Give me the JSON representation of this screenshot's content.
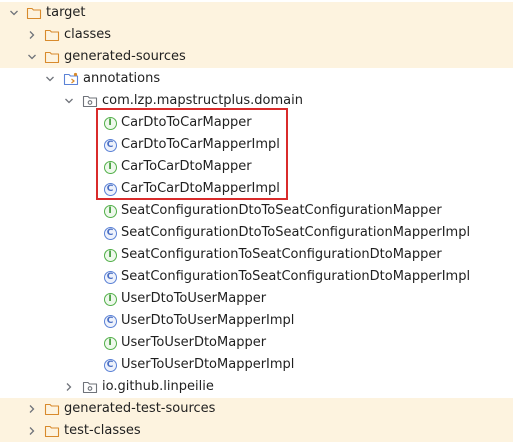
{
  "tree": {
    "target": "target",
    "classes": "classes",
    "generated_sources": "generated-sources",
    "annotations": "annotations",
    "package_domain": "com.lzp.mapstructplus.domain",
    "items": [
      {
        "label": "CarDtoToCarMapper",
        "kind": "interface",
        "badge": "I"
      },
      {
        "label": "CarDtoToCarMapperImpl",
        "kind": "class",
        "badge": "C"
      },
      {
        "label": "CarToCarDtoMapper",
        "kind": "interface",
        "badge": "I"
      },
      {
        "label": "CarToCarDtoMapperImpl",
        "kind": "class",
        "badge": "C"
      },
      {
        "label": "SeatConfigurationDtoToSeatConfigurationMapper",
        "kind": "interface",
        "badge": "I"
      },
      {
        "label": "SeatConfigurationDtoToSeatConfigurationMapperImpl",
        "kind": "class",
        "badge": "C"
      },
      {
        "label": "SeatConfigurationToSeatConfigurationDtoMapper",
        "kind": "interface",
        "badge": "I"
      },
      {
        "label": "SeatConfigurationToSeatConfigurationDtoMapperImpl",
        "kind": "class",
        "badge": "C"
      },
      {
        "label": "UserDtoToUserMapper",
        "kind": "interface",
        "badge": "I"
      },
      {
        "label": "UserDtoToUserMapperImpl",
        "kind": "class",
        "badge": "C"
      },
      {
        "label": "UserToUserDtoMapper",
        "kind": "interface",
        "badge": "I"
      },
      {
        "label": "UserToUserDtoMapperImpl",
        "kind": "class",
        "badge": "C"
      }
    ],
    "package_github": "io.github.linpeilie",
    "generated_test_sources": "generated-test-sources",
    "test_classes": "test-classes"
  },
  "colors": {
    "excluded_folder_background": "#fdf3df",
    "folder_outline": "#d88a2c",
    "highlight_box": "#d92b2b",
    "interface_badge": "#53b04a",
    "class_badge": "#5b82d6"
  },
  "icons": {
    "expanded": "chevron-down-icon",
    "collapsed": "chevron-right-icon",
    "folder": "folder-icon",
    "source_root": "source-root-folder-icon",
    "package": "package-icon",
    "interface": "interface-icon",
    "class": "class-icon"
  }
}
